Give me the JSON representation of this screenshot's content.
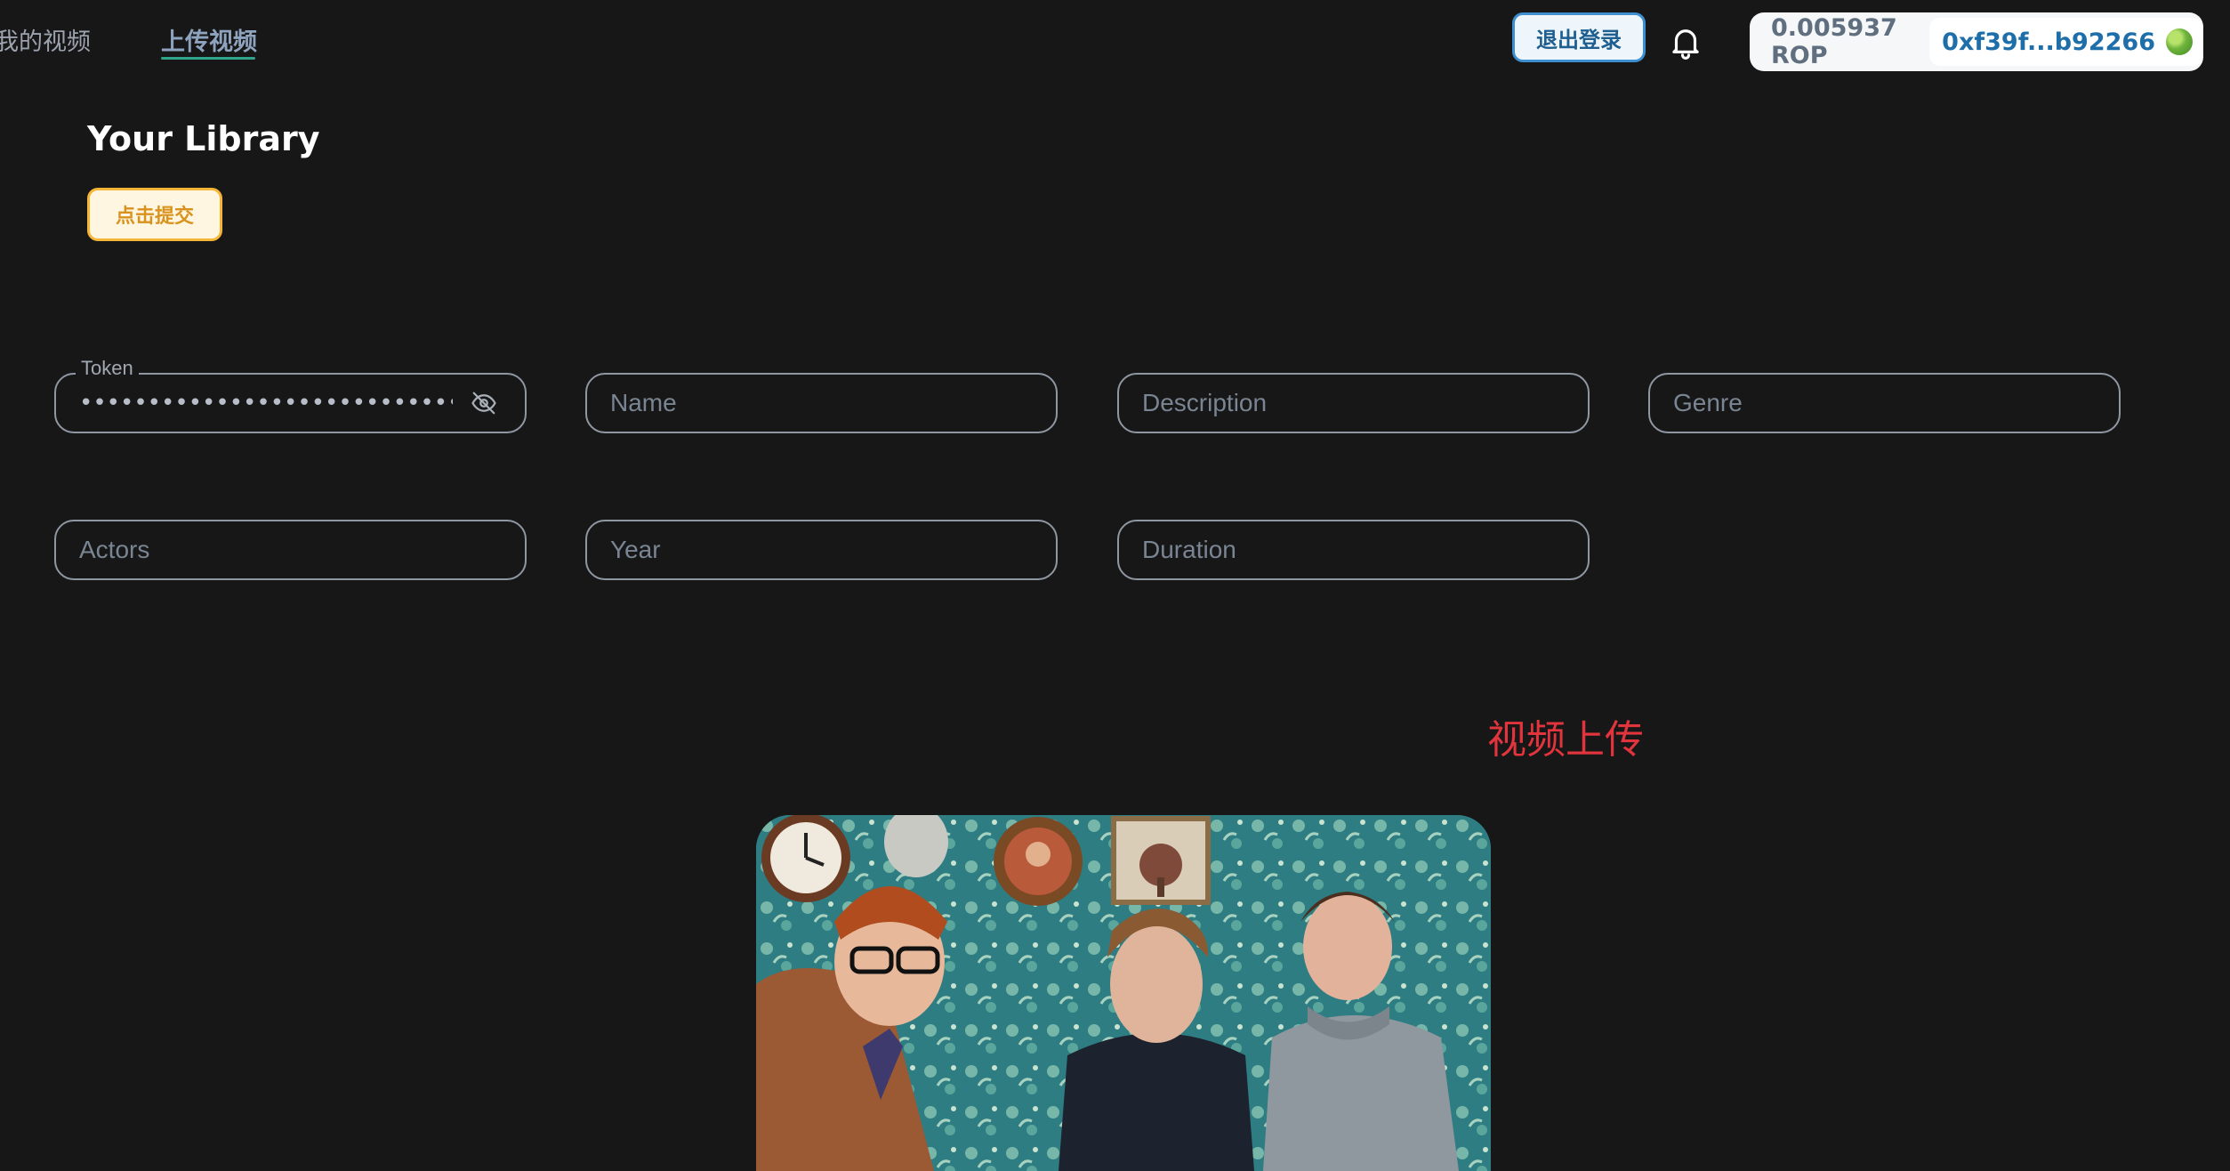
{
  "nav": {
    "my_videos": "我的视频",
    "upload_video": "上传视频"
  },
  "header": {
    "logout_label": "退出登录",
    "wallet_balance": "0.005937 ROP",
    "wallet_address": "0xf39f...b92266"
  },
  "library": {
    "title": "Your Library",
    "submit_label": "点击提交"
  },
  "form": {
    "token_label": "Token",
    "token_value": "••••••••••••••••••••••••••••••••",
    "name_placeholder": "Name",
    "description_placeholder": "Description",
    "genre_placeholder": "Genre",
    "actors_placeholder": "Actors",
    "year_placeholder": "Year",
    "duration_placeholder": "Duration"
  },
  "upload": {
    "title": "视频上传"
  },
  "colors": {
    "background": "#171717",
    "accent_green": "#2fa58c",
    "logout_border": "#3e8fcf",
    "submit_border": "#f5b536",
    "upload_title": "#e2343d"
  },
  "icons": [
    "bell-icon",
    "eye-off-icon",
    "wallet-avatar-icon"
  ]
}
